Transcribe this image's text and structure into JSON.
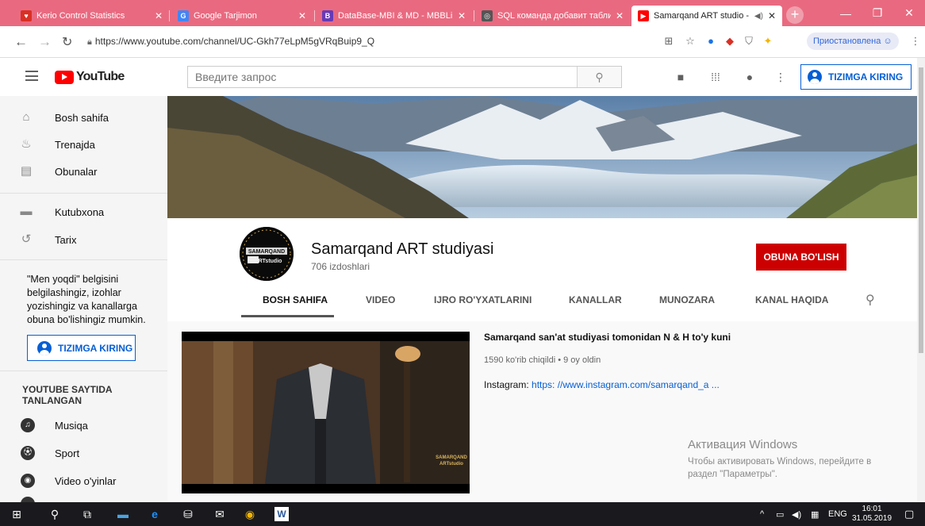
{
  "browser": {
    "tabs": [
      {
        "title": "Kerio Control Statistics",
        "favicon_color": "#d93025",
        "favicon_glyph": "♥"
      },
      {
        "title": "Google Tarjimon",
        "favicon_color": "#4285f4",
        "favicon_glyph": "G"
      },
      {
        "title": "DataBase-MBI & MD - MBBLin",
        "favicon_color": "#673ab7",
        "favicon_glyph": "B"
      },
      {
        "title": "SQL команда добавит таблиц",
        "favicon_color": "#555555",
        "favicon_glyph": "◎"
      },
      {
        "title": "Samarqand ART studio - Y",
        "favicon_color": "#ff0000",
        "favicon_glyph": "▶"
      }
    ],
    "url": "https://www.youtube.com/channel/UC-Gkh77eLpM5gVRqBuip9_Q",
    "paused_label": "Приостановлена"
  },
  "header": {
    "logo_text": "YouTube",
    "search_placeholder": "Введите запрос",
    "signin_label": "TIZIMGA KIRING"
  },
  "sidebar": {
    "items": [
      {
        "label": "Bosh sahifa",
        "icon": "home-icon"
      },
      {
        "label": "Trenajda",
        "icon": "trending-icon"
      },
      {
        "label": "Obunalar",
        "icon": "subscriptions-icon"
      },
      {
        "label": "Kutubxona",
        "icon": "library-icon"
      },
      {
        "label": "Tarix",
        "icon": "history-icon"
      }
    ],
    "promo_text": "\"Men yoqdi\" belgisini belgilashingiz, izohlar yozishingiz va kanallarga obuna bo'lishingiz mumkin.",
    "signin_label": "TIZIMGA KIRING",
    "section_title": "YOUTUBE SAYTIDA TANLANGAN",
    "section_items": [
      {
        "label": "Musiqa",
        "icon": "music-icon"
      },
      {
        "label": "Sport",
        "icon": "sport-icon"
      },
      {
        "label": "Video o'yinlar",
        "icon": "gaming-icon"
      }
    ]
  },
  "channel": {
    "name": "Samarqand ART studiyasi",
    "subscribers": "706 izdoshlari",
    "subscribe_label": "OBUNA BO'LISH",
    "avatar_text_top": "SAMARQAND",
    "avatar_text_bottom": "ARTstudio",
    "tabs": [
      "BOSH SAHIFA",
      "VIDEO",
      "IJRO RO'YXATLARINI",
      "KANALLAR",
      "MUNOZARA",
      "KANAL HAQIDA"
    ],
    "active_tab": "BOSH SAHIFA"
  },
  "featured_video": {
    "title": "Samarqand san'at studiyasi tomonidan N & H to'y kuni",
    "meta": "1590 ko'rib chiqildi  • 9 oy oldin",
    "desc_prefix": "Instagram: ",
    "desc_link": "https: //www.instagram.com/samarqand_a ...",
    "thumb_watermark_top": "SAMARQAND",
    "thumb_watermark_bottom": "ARTstudio"
  },
  "watermark": {
    "title": "Активация Windows",
    "body": "Чтобы активировать Windows, перейдите в раздел \"Параметры\"."
  },
  "taskbar": {
    "lang": "ENG",
    "time": "16:01",
    "date": "31.05.2019"
  },
  "colors": {
    "tabstrip": "#e96a80",
    "youtube_red": "#ff0000",
    "subscribe_red": "#cc0000",
    "link_blue": "#065fd4"
  }
}
